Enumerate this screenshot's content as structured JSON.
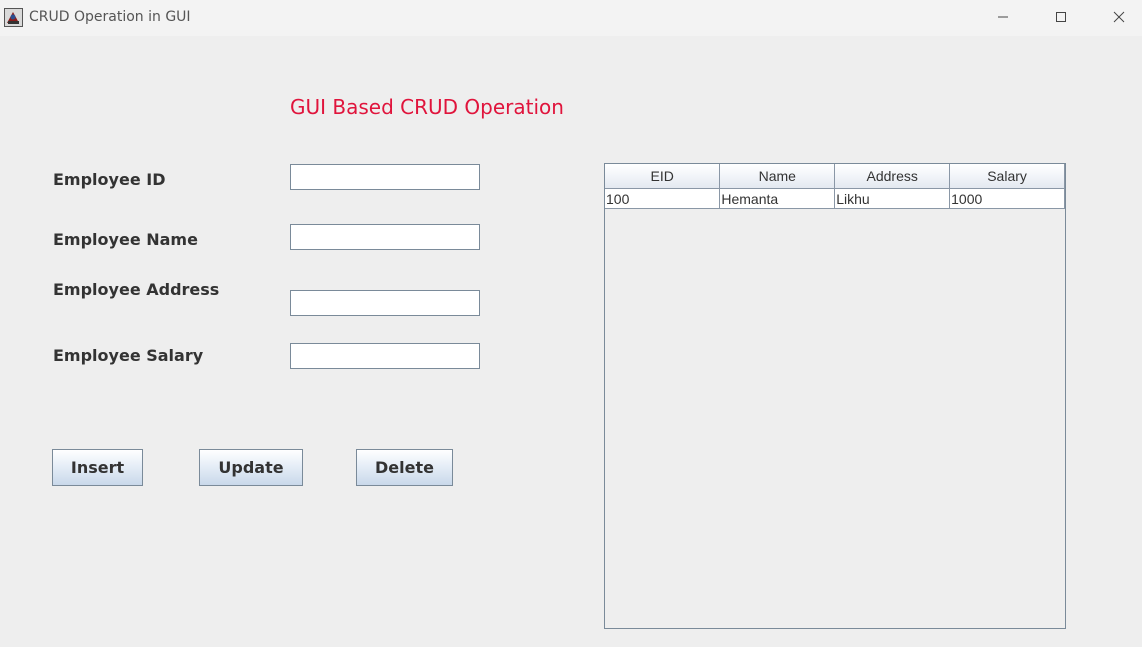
{
  "window": {
    "title": "CRUD Operation in GUI",
    "icons": {
      "app": "java-app-icon",
      "minimize": "minimize-icon",
      "maximize": "maximize-icon",
      "close": "close-icon"
    }
  },
  "form": {
    "heading": "GUI Based CRUD Operation",
    "heading_color": "#e0143c",
    "fields": [
      {
        "label": "Employee ID",
        "value": ""
      },
      {
        "label": "Employee Name",
        "value": ""
      },
      {
        "label": "Employee Address",
        "value": ""
      },
      {
        "label": "Employee Salary",
        "value": ""
      }
    ],
    "buttons": {
      "insert": "Insert",
      "update": "Update",
      "delete": "Delete"
    }
  },
  "table": {
    "columns": [
      "EID",
      "Name",
      "Address",
      "Salary"
    ],
    "rows": [
      [
        "100",
        "Hemanta",
        "Likhu",
        "1000"
      ]
    ]
  }
}
